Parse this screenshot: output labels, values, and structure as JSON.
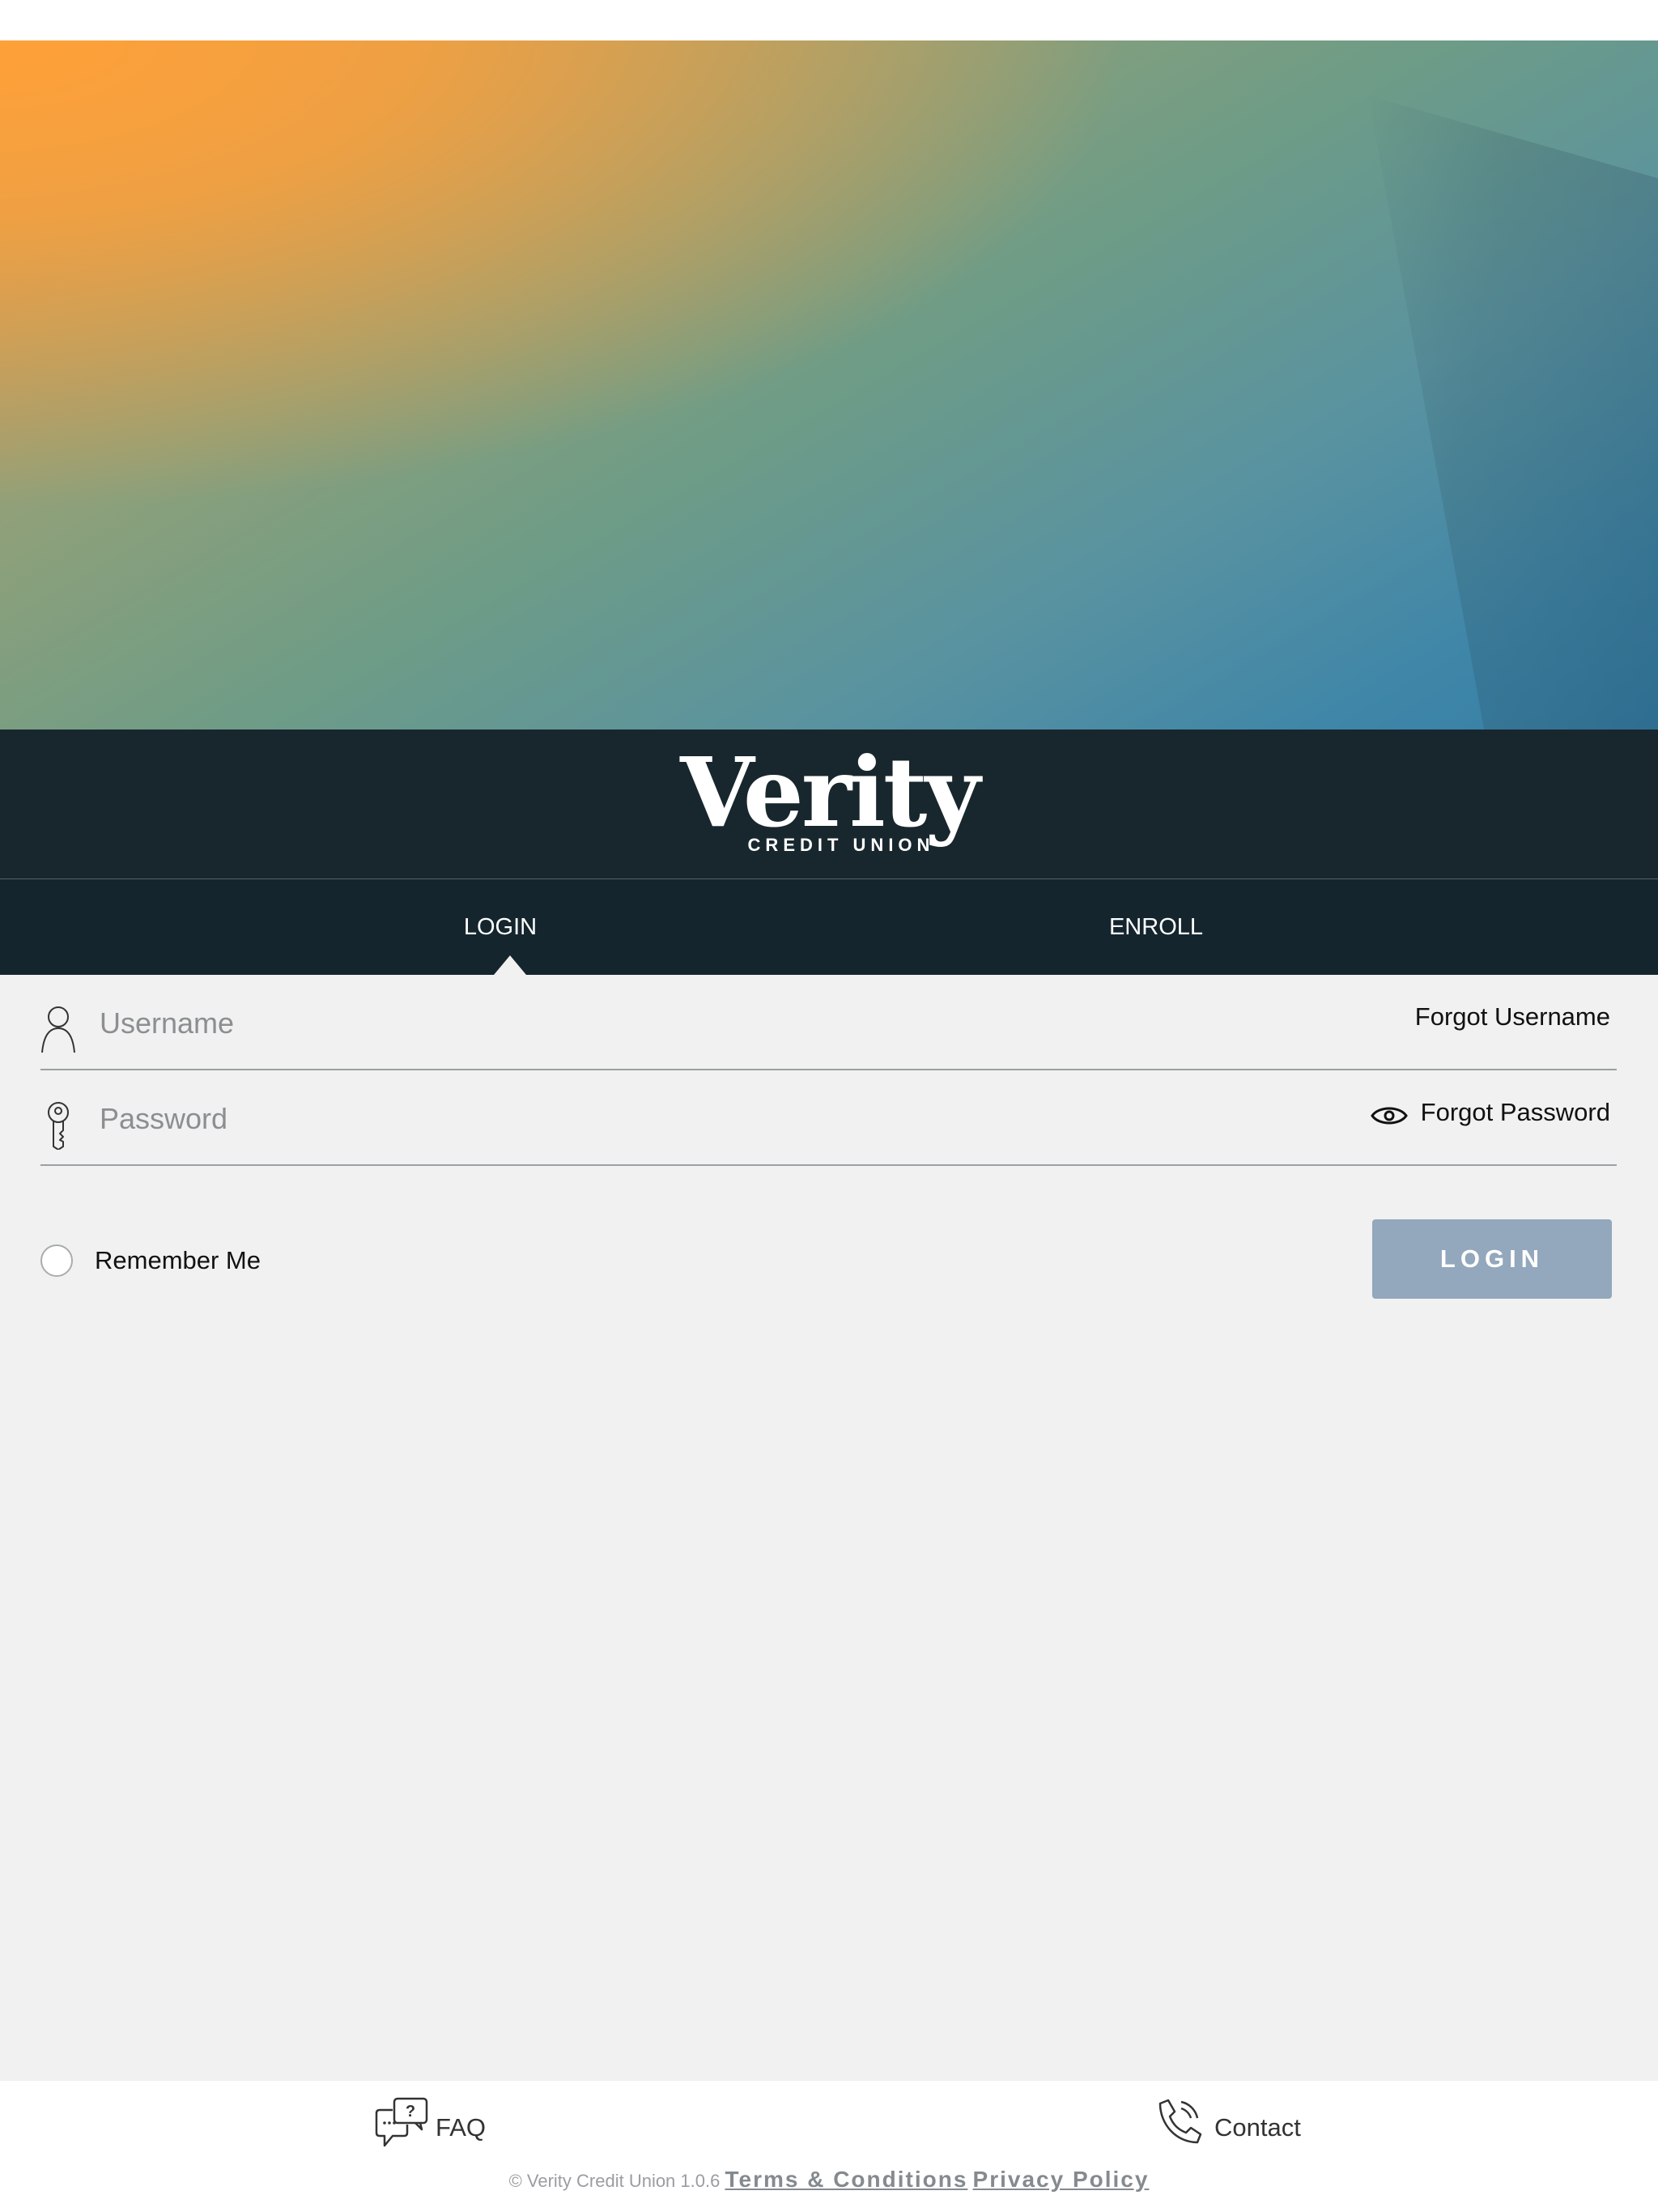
{
  "brand": {
    "name": "Verity",
    "subtitle": "CREDIT UNION"
  },
  "tabs": [
    {
      "label": "LOGIN",
      "active": true
    },
    {
      "label": "ENROLL",
      "active": false
    }
  ],
  "form": {
    "username": {
      "placeholder": "Username",
      "value": "",
      "forgot_label": "Forgot Username",
      "icon": "user-icon"
    },
    "password": {
      "placeholder": "Password",
      "value": "",
      "forgot_label": "Forgot Password",
      "icon": "key-icon",
      "reveal_icon": "eye-icon"
    },
    "remember_me": {
      "label": "Remember Me",
      "checked": false
    },
    "login_button": {
      "label": "LOGIN",
      "color": "#93a7bd"
    }
  },
  "footer": {
    "faq": {
      "label": "FAQ",
      "icon": "faq-chat-icon"
    },
    "contact": {
      "label": "Contact",
      "icon": "phone-icon"
    },
    "copyright": "© Verity Credit Union 1.0.6",
    "terms": "Terms & Conditions",
    "privacy": "Privacy Policy"
  },
  "colors": {
    "brand_band": "#18272e",
    "form_bg": "#f0f1f0",
    "accent_orange": "#ffa038",
    "accent_blue": "#357ea6"
  }
}
